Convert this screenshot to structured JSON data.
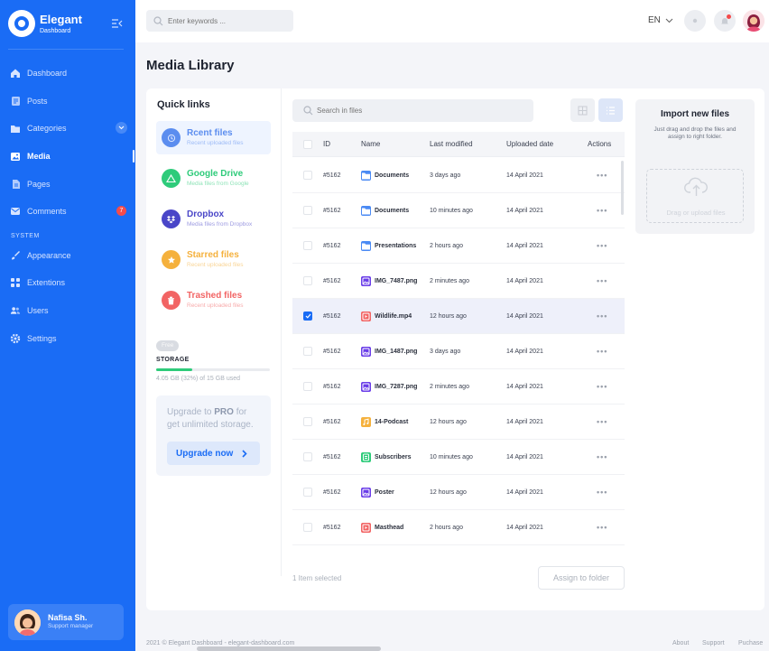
{
  "sidebar": {
    "brand_name": "Elegant",
    "brand_sub": "Dashboard",
    "items": [
      {
        "label": "Dashboard",
        "icon": "home-icon"
      },
      {
        "label": "Posts",
        "icon": "document-icon"
      },
      {
        "label": "Categories",
        "icon": "folder-icon"
      },
      {
        "label": "Media",
        "icon": "image-icon"
      },
      {
        "label": "Pages",
        "icon": "page-icon"
      },
      {
        "label": "Comments",
        "icon": "mail-icon",
        "badge": "7"
      }
    ],
    "system_label": "SYSTEM",
    "system_items": [
      {
        "label": "Appearance",
        "icon": "brush-icon"
      },
      {
        "label": "Extentions",
        "icon": "grid-icon"
      },
      {
        "label": "Users",
        "icon": "users-icon"
      },
      {
        "label": "Settings",
        "icon": "gear-icon"
      }
    ],
    "user": {
      "name": "Nafisa Sh.",
      "role": "Support manager"
    }
  },
  "topbar": {
    "search_placeholder": "Enter keywords ...",
    "language": "EN"
  },
  "page_title": "Media Library",
  "quick_links": {
    "title": "Quick links",
    "items": [
      {
        "title": "Rcent files",
        "subtitle": "Recent uploaded files",
        "color": "#5b8def"
      },
      {
        "title": "Google Drive",
        "subtitle": "Media files from Google",
        "color": "#2ecb7a"
      },
      {
        "title": "Dropbox",
        "subtitle": "Media files from Dropbox",
        "color": "#4a46c8"
      },
      {
        "title": "Starred files",
        "subtitle": "Recent uploaded files",
        "color": "#f5b13d"
      },
      {
        "title": "Trashed files",
        "subtitle": "Recent uploaded files",
        "color": "#f26464"
      }
    ]
  },
  "storage": {
    "badge": "Free",
    "label": "STORAGE",
    "used_fraction": 0.32,
    "text": "4.05 GB (32%) of 15 GB used"
  },
  "upgrade": {
    "text_pre": "Upgrade to ",
    "text_bold": "PRO",
    "text_post": " for get unlimited storage.",
    "button": "Upgrade now"
  },
  "files": {
    "search_placeholder": "Search in files",
    "columns": [
      "ID",
      "Name",
      "Last modified",
      "Uploaded date",
      "Actions"
    ],
    "rows": [
      {
        "id": "#5162",
        "name": "Documents",
        "type": "folder",
        "modified": "3 days ago",
        "uploaded": "14 April 2021",
        "selected": false
      },
      {
        "id": "#5162",
        "name": "Documents",
        "type": "folder",
        "modified": "10 minutes ago",
        "uploaded": "14 April 2021",
        "selected": false
      },
      {
        "id": "#5162",
        "name": "Presentations",
        "type": "folder",
        "modified": "2 hours ago",
        "uploaded": "14 April 2021",
        "selected": false
      },
      {
        "id": "#5162",
        "name": "IMG_7487.png",
        "type": "image",
        "modified": "2 minutes ago",
        "uploaded": "14 April 2021",
        "selected": false
      },
      {
        "id": "#5162",
        "name": "Wildlife.mp4",
        "type": "video",
        "modified": "12 hours ago",
        "uploaded": "14 April 2021",
        "selected": true
      },
      {
        "id": "#5162",
        "name": "IMG_1487.png",
        "type": "image",
        "modified": "3 days ago",
        "uploaded": "14 April 2021",
        "selected": false
      },
      {
        "id": "#5162",
        "name": "IMG_7287.png",
        "type": "image",
        "modified": "2 minutes ago",
        "uploaded": "14 April 2021",
        "selected": false
      },
      {
        "id": "#5162",
        "name": "14-Podcast",
        "type": "audio",
        "modified": "12 hours ago",
        "uploaded": "14 April 2021",
        "selected": false
      },
      {
        "id": "#5162",
        "name": "Subscribers",
        "type": "sheet",
        "modified": "10 minutes ago",
        "uploaded": "14 April 2021",
        "selected": false
      },
      {
        "id": "#5162",
        "name": "Poster",
        "type": "image",
        "modified": "12 hours ago",
        "uploaded": "14 April 2021",
        "selected": false
      },
      {
        "id": "#5162",
        "name": "Masthead",
        "type": "video",
        "modified": "2 hours ago",
        "uploaded": "14 April 2021",
        "selected": false
      }
    ],
    "actions_glyph": "•••",
    "selected_text": "1 Item selected",
    "assign_button": "Assign to folder"
  },
  "import": {
    "title": "Import new files",
    "subtitle": "Just drag and drop the files and assign to right folder.",
    "drop_label": "Drag or upload files"
  },
  "footer": {
    "copyright": "2021 © Elegant Dashboard - elegant-dashboard.com",
    "links": [
      "About",
      "Support",
      "Puchase"
    ]
  },
  "colors": {
    "accent": "#1a6cf5",
    "folder": "#4a8af4",
    "image": "#6a3de8",
    "video": "#f26464",
    "audio": "#f5b13d",
    "sheet": "#2ecb7a"
  }
}
